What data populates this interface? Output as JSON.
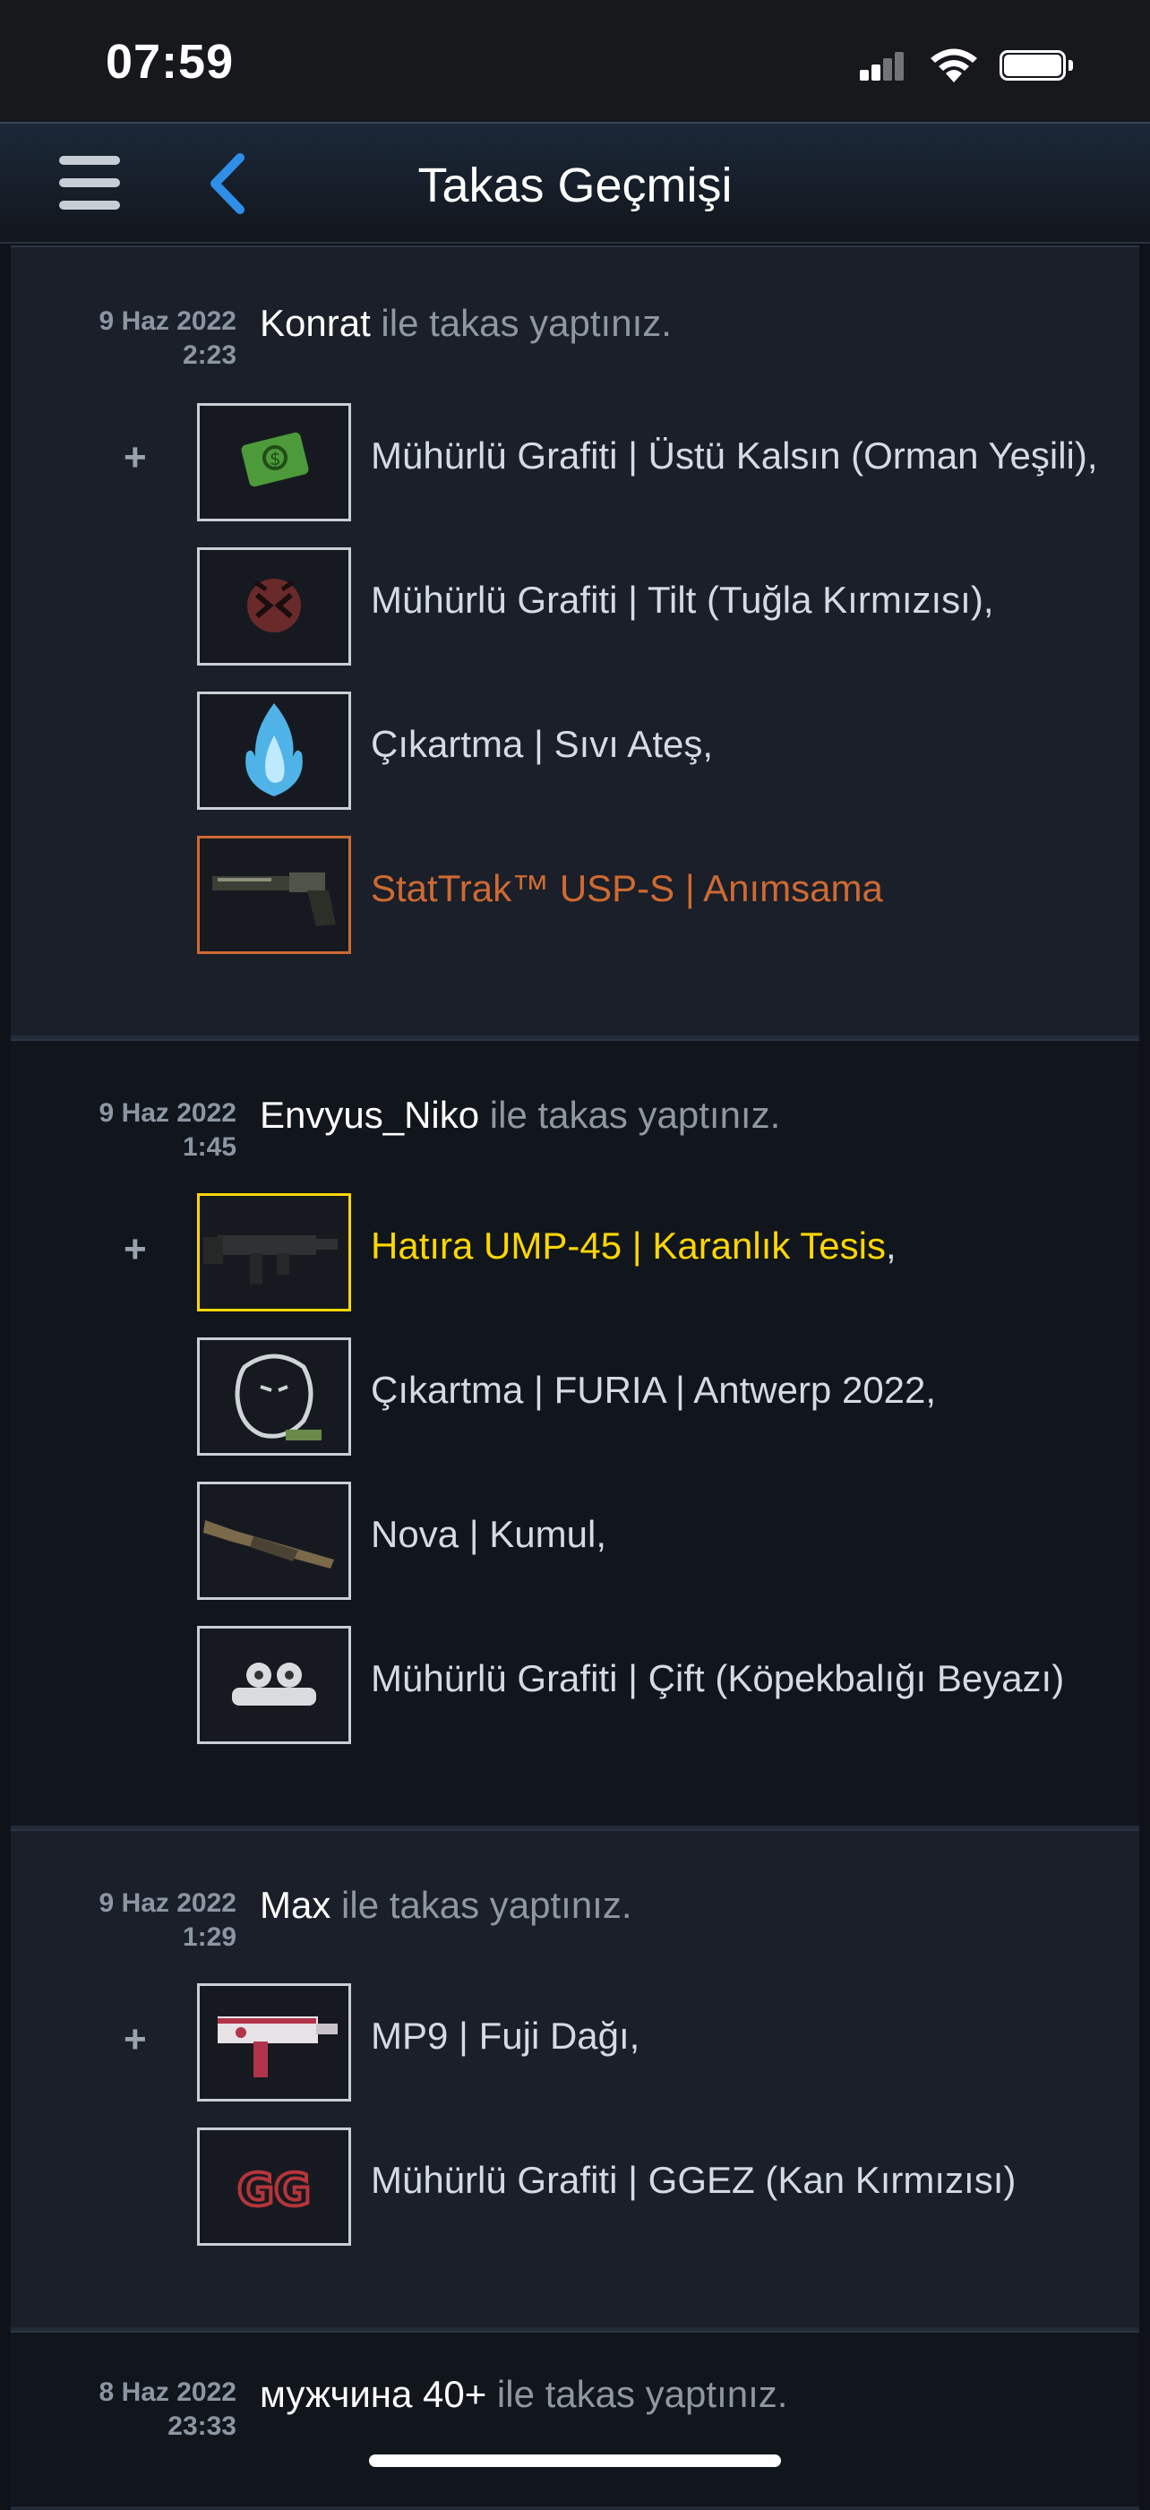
{
  "status_bar": {
    "time": "07:59"
  },
  "navbar": {
    "title": "Takas Geçmişi"
  },
  "trade_suffix": " ile takas yaptınız.",
  "trades": [
    {
      "date": "9 Haz 2022",
      "time": "2:23",
      "partner": "Konrat",
      "items": [
        {
          "name": "Mühürlü Grafiti | Üstü Kalsın (Orman Yeşili)",
          "sep": ",",
          "color": "#d4dbe2",
          "border": "#c9cfd5",
          "icon": "money-graffiti-icon"
        },
        {
          "name": "Mühürlü Grafiti | Tilt (Tuğla Kırmızısı)",
          "sep": ",",
          "color": "#d4dbe2",
          "border": "#c9cfd5",
          "icon": "tilt-graffiti-icon"
        },
        {
          "name": "Çıkartma | Sıvı Ateş",
          "sep": ",",
          "color": "#d4dbe2",
          "border": "#c9cfd5",
          "icon": "blue-fire-sticker-icon"
        },
        {
          "name": "StatTrak™ USP-S | Anımsama",
          "sep": "",
          "color": "#cf6a32",
          "border": "#cf6a32",
          "icon": "pistol-icon"
        }
      ]
    },
    {
      "date": "9 Haz 2022",
      "time": "1:45",
      "partner": "Envyus_Niko",
      "items": [
        {
          "name": "Hatıra UMP-45 | Karanlık Tesis",
          "sep": ",",
          "color": "#ffd700",
          "border": "#ffd700",
          "icon": "smg-icon"
        },
        {
          "name": "Çıkartma | FURIA | Antwerp 2022",
          "sep": ",",
          "color": "#d4dbe2",
          "border": "#c9cfd5",
          "icon": "panther-sticker-icon"
        },
        {
          "name": "Nova | Kumul",
          "sep": ",",
          "color": "#d4dbe2",
          "border": "#c9cfd5",
          "icon": "shotgun-icon"
        },
        {
          "name": "Mühürlü Grafiti | Çift (Köpekbalığı Beyazı)",
          "sep": "",
          "color": "#d4dbe2",
          "border": "#c9cfd5",
          "icon": "double-graffiti-icon"
        }
      ]
    },
    {
      "date": "9 Haz 2022",
      "time": "1:29",
      "partner": "Max",
      "items": [
        {
          "name": "MP9 | Fuji Dağı",
          "sep": ",",
          "color": "#d4dbe2",
          "border": "#c9cfd5",
          "icon": "mp9-icon"
        },
        {
          "name": "Mühürlü Grafiti | GGEZ (Kan Kırmızısı)",
          "sep": "",
          "color": "#d4dbe2",
          "border": "#c9cfd5",
          "icon": "ggez-graffiti-icon"
        }
      ]
    },
    {
      "date": "8 Haz 2022",
      "time": "23:33",
      "partner": "мужчина 40+",
      "items": []
    }
  ]
}
